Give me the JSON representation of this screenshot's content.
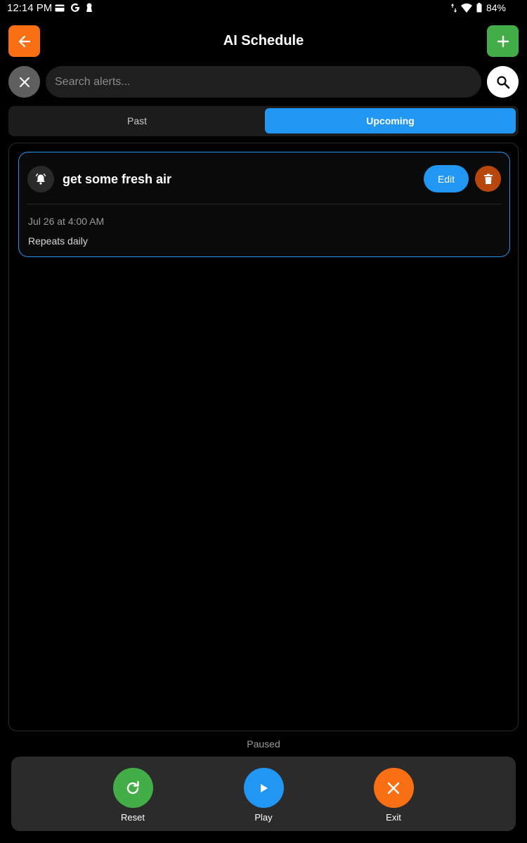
{
  "status_bar": {
    "time": "12:14 PM",
    "battery": "84%",
    "left_icons": [
      "card-icon",
      "google-icon",
      "keyhole-icon"
    ],
    "right_icons": [
      "data-arrows-icon",
      "wifi-icon",
      "battery-icon"
    ]
  },
  "header": {
    "title": "AI Schedule",
    "back_icon": "arrow-left-icon",
    "add_icon": "plus-icon"
  },
  "search": {
    "placeholder": "Search alerts...",
    "value": ""
  },
  "tabs": [
    {
      "label": "Past",
      "selected": false
    },
    {
      "label": "Upcoming",
      "selected": true
    }
  ],
  "alerts": [
    {
      "title": "get some fresh air",
      "edit_label": "Edit",
      "date": "Jul 26 at 4:00 AM",
      "repeat": "Repeats daily"
    }
  ],
  "status_text": "Paused",
  "controls": {
    "reset_label": "Reset",
    "play_label": "Play",
    "exit_label": "Exit"
  },
  "colors": {
    "accent_blue": "#2196f3",
    "orange": "#f96f13",
    "green": "#43ad47",
    "delete_red": "#b8470d",
    "background": "#000000"
  }
}
